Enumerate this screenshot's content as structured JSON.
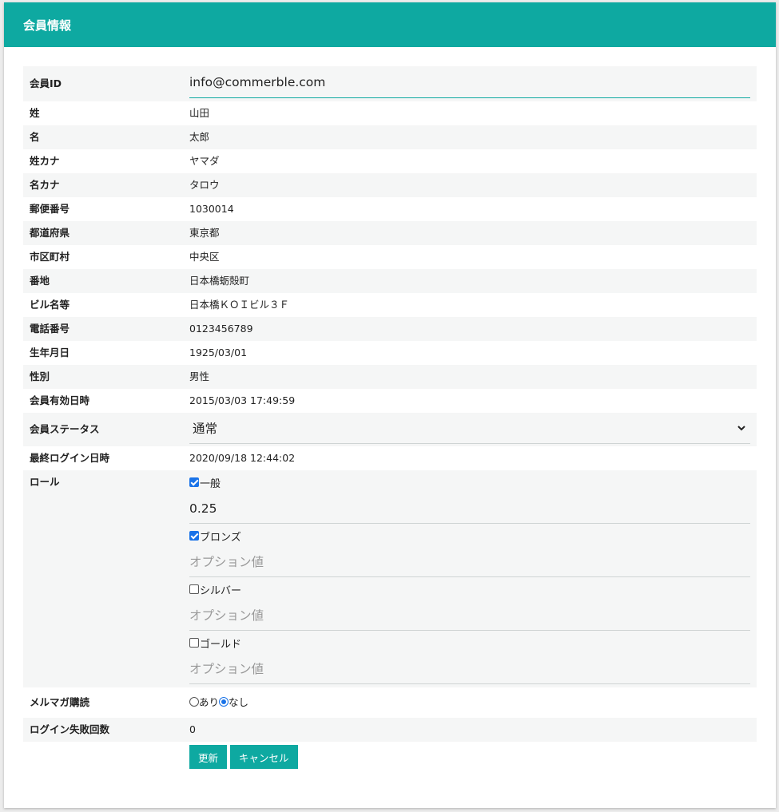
{
  "header": {
    "title": "会員情報"
  },
  "fields": {
    "member_id": {
      "label": "会員ID",
      "value": "info@commerble.com"
    },
    "last_name": {
      "label": "姓",
      "value": "山田"
    },
    "first_name": {
      "label": "名",
      "value": "太郎"
    },
    "last_name_kana": {
      "label": "姓カナ",
      "value": "ヤマダ"
    },
    "first_name_kana": {
      "label": "名カナ",
      "value": "タロウ"
    },
    "postal_code": {
      "label": "郵便番号",
      "value": "1030014"
    },
    "prefecture": {
      "label": "都道府県",
      "value": "東京都"
    },
    "city": {
      "label": "市区町村",
      "value": "中央区"
    },
    "address": {
      "label": "番地",
      "value": "日本橋蛎殻町"
    },
    "building": {
      "label": "ビル名等",
      "value": "日本橋ＫＯＩビル３Ｆ"
    },
    "phone": {
      "label": "電話番号",
      "value": "0123456789"
    },
    "birthdate": {
      "label": "生年月日",
      "value": "1925/03/01"
    },
    "gender": {
      "label": "性別",
      "value": "男性"
    },
    "valid_datetime": {
      "label": "会員有効日時",
      "value": "2015/03/03 17:49:59"
    },
    "status": {
      "label": "会員ステータス",
      "value": "通常"
    },
    "last_login": {
      "label": "最終ログイン日時",
      "value": "2020/09/18 12:44:02"
    },
    "role": {
      "label": "ロール",
      "options": [
        {
          "name": "一般",
          "checked": true,
          "value": "0.25",
          "placeholder": "オプション値"
        },
        {
          "name": "ブロンズ",
          "checked": true,
          "value": "",
          "placeholder": "オプション値"
        },
        {
          "name": "シルバー",
          "checked": false,
          "value": "",
          "placeholder": "オプション値"
        },
        {
          "name": "ゴールド",
          "checked": false,
          "value": "",
          "placeholder": "オプション値"
        }
      ]
    },
    "newsletter": {
      "label": "メルマガ購読",
      "opt_yes": "あり",
      "opt_no": "なし",
      "selected": "なし"
    },
    "login_failures": {
      "label": "ログイン失敗回数",
      "value": "0"
    }
  },
  "buttons": {
    "update": "更新",
    "cancel": "キャンセル"
  },
  "colors": {
    "accent": "#0ea9a1",
    "checkbox": "#1a73e8"
  },
  "icons": {
    "status_dropdown": "chevron-down-icon"
  }
}
